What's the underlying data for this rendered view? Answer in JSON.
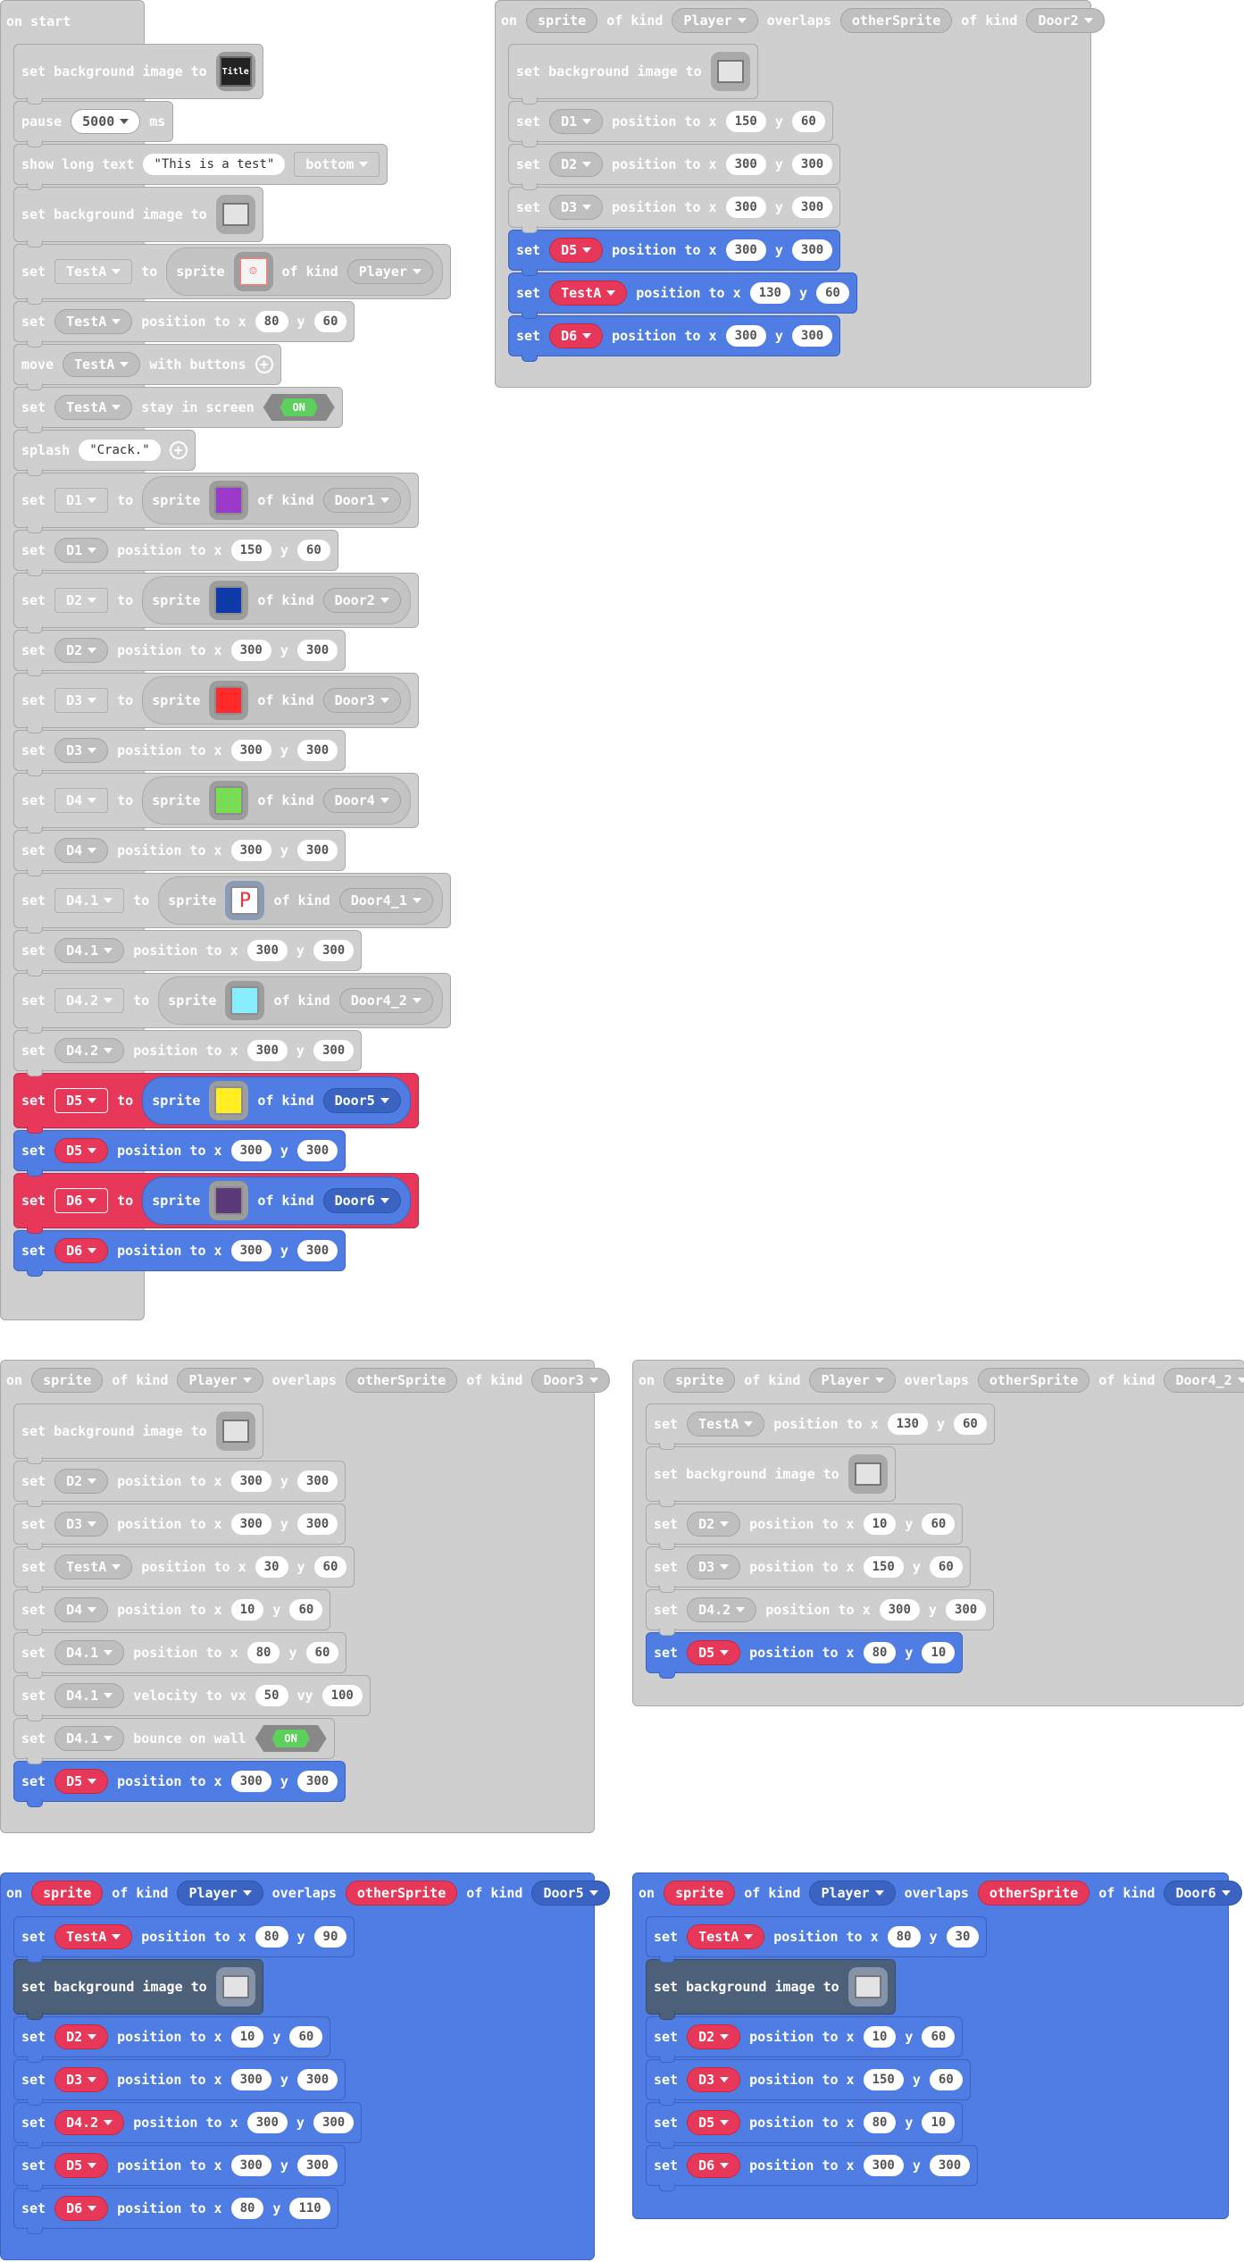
{
  "kw": {
    "on": "on",
    "on_start": "on start",
    "set": "set",
    "to": "to",
    "sprite": "sprite",
    "of_kind": "of kind",
    "overlaps": "overlaps",
    "position_to_x": "position to x",
    "y": "y",
    "set_bg": "set background image to",
    "pause": "pause",
    "ms": "ms",
    "show_long_text": "show long text",
    "move": "move",
    "with_buttons": "with buttons",
    "stay_in_screen": "stay in screen",
    "splash": "splash",
    "velocity_to_vx": "velocity to vx",
    "vy": "vy",
    "bounce_on_wall": "bounce on wall",
    "on_toggle": "ON"
  },
  "start": {
    "pause_ms": "5000",
    "long_text": "This is a test",
    "text_pos": "bottom",
    "splash_text": "Crack.",
    "sprites": [
      {
        "var": "TestA",
        "kind": "Player",
        "x": "80",
        "y": "60"
      },
      {
        "var": "D1",
        "kind": "Door1",
        "x": "150",
        "y": "60",
        "color": "#9b39c9"
      },
      {
        "var": "D2",
        "kind": "Door2",
        "x": "300",
        "y": "300",
        "color": "#0c3aa8"
      },
      {
        "var": "D3",
        "kind": "Door3",
        "x": "300",
        "y": "300",
        "color": "#ff2a2a"
      },
      {
        "var": "D4",
        "kind": "Door4",
        "x": "300",
        "y": "300",
        "color": "#77dd55"
      },
      {
        "var": "D4.1",
        "kind": "Door4_1",
        "x": "300",
        "y": "300",
        "color": "#ffffff"
      },
      {
        "var": "D4.2",
        "kind": "Door4_2",
        "x": "300",
        "y": "300",
        "color": "#88eeff"
      },
      {
        "var": "D5",
        "kind": "Door5",
        "x": "300",
        "y": "300",
        "color": "#ffee22"
      },
      {
        "var": "D6",
        "kind": "Door6",
        "x": "300",
        "y": "300",
        "color": "#5a3a78"
      }
    ]
  },
  "ov": {
    "sprite": "sprite",
    "player": "Player",
    "other": "otherSprite"
  },
  "e2": {
    "kind": "Door2",
    "rows": [
      {
        "v": "D1",
        "x": "150",
        "y": "60"
      },
      {
        "v": "D2",
        "x": "300",
        "y": "300"
      },
      {
        "v": "D3",
        "x": "300",
        "y": "300"
      },
      {
        "v": "D5",
        "x": "300",
        "y": "300"
      },
      {
        "v": "TestA",
        "x": "130",
        "y": "60"
      },
      {
        "v": "D6",
        "x": "300",
        "y": "300"
      }
    ]
  },
  "e3": {
    "kind": "Door3",
    "rows": [
      {
        "v": "D2",
        "x": "300",
        "y": "300"
      },
      {
        "v": "D3",
        "x": "300",
        "y": "300"
      },
      {
        "v": "TestA",
        "x": "30",
        "y": "60"
      },
      {
        "v": "D4",
        "x": "10",
        "y": "60"
      },
      {
        "v": "D4.1",
        "x": "80",
        "y": "60"
      }
    ],
    "vel": {
      "v": "D4.1",
      "vx": "50",
      "vy": "100"
    },
    "bounce": "D4.1",
    "last": {
      "v": "D5",
      "x": "300",
      "y": "300"
    }
  },
  "e42": {
    "kind": "Door4_2",
    "first": {
      "v": "TestA",
      "x": "130",
      "y": "60"
    },
    "rows": [
      {
        "v": "D2",
        "x": "10",
        "y": "60"
      },
      {
        "v": "D3",
        "x": "150",
        "y": "60"
      },
      {
        "v": "D4.2",
        "x": "300",
        "y": "300"
      },
      {
        "v": "D5",
        "x": "80",
        "y": "10"
      }
    ]
  },
  "e5": {
    "kind": "Door5",
    "first": {
      "v": "TestA",
      "x": "80",
      "y": "90"
    },
    "rows": [
      {
        "v": "D2",
        "x": "10",
        "y": "60"
      },
      {
        "v": "D3",
        "x": "300",
        "y": "300"
      },
      {
        "v": "D4.2",
        "x": "300",
        "y": "300"
      },
      {
        "v": "D5",
        "x": "300",
        "y": "300"
      },
      {
        "v": "D6",
        "x": "80",
        "y": "110"
      }
    ]
  },
  "e6": {
    "kind": "Door6",
    "first": {
      "v": "TestA",
      "x": "80",
      "y": "30"
    },
    "rows": [
      {
        "v": "D2",
        "x": "10",
        "y": "60"
      },
      {
        "v": "D3",
        "x": "150",
        "y": "60"
      },
      {
        "v": "D5",
        "x": "80",
        "y": "10"
      },
      {
        "v": "D6",
        "x": "300",
        "y": "300"
      }
    ]
  }
}
